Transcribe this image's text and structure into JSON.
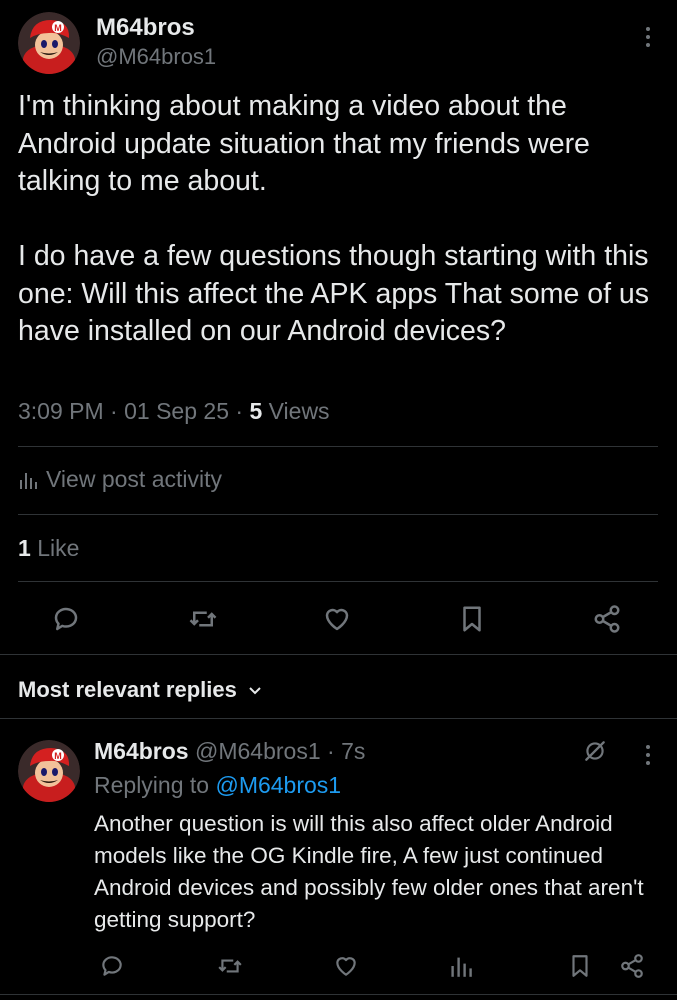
{
  "post": {
    "author_name": "M64bros",
    "author_handle": "@M64bros1",
    "paragraph_1": "I'm thinking about making a video about the Android update situation that my friends were talking to me about.",
    "paragraph_2": "I do have a few questions though starting with this one: Will this affect the APK apps That some of us have installed on our Android devices?",
    "time": "3:09 PM",
    "date": "01 Sep 25",
    "views_count": "5",
    "views_label": "Views",
    "activity_label": "View post activity",
    "likes_count": "1",
    "likes_label": "Like",
    "separator": "·"
  },
  "replies_section": {
    "label": "Most relevant replies"
  },
  "reply": {
    "author_name": "M64bros",
    "author_handle": "@M64bros1",
    "age": "7s",
    "replying_to_label": "Replying to",
    "replying_to_handle": "@M64bros1",
    "text": "Another question is will this also affect older Android models like the OG Kindle fire, A few just continued Android devices and possibly few older ones that aren't getting support?"
  },
  "icons": {
    "reply": "reply-icon",
    "repost": "repost-icon",
    "like": "heart-icon",
    "bookmark": "bookmark-icon",
    "share": "share-icon",
    "analytics": "analytics-icon",
    "more": "more-vertical-icon",
    "chevron": "chevron-down-icon",
    "grok": "grok-icon"
  },
  "colors": {
    "background": "#000000",
    "text_primary": "#e7e9ea",
    "text_secondary": "#71767b",
    "link": "#1d9bf0",
    "divider": "#2f3336"
  }
}
